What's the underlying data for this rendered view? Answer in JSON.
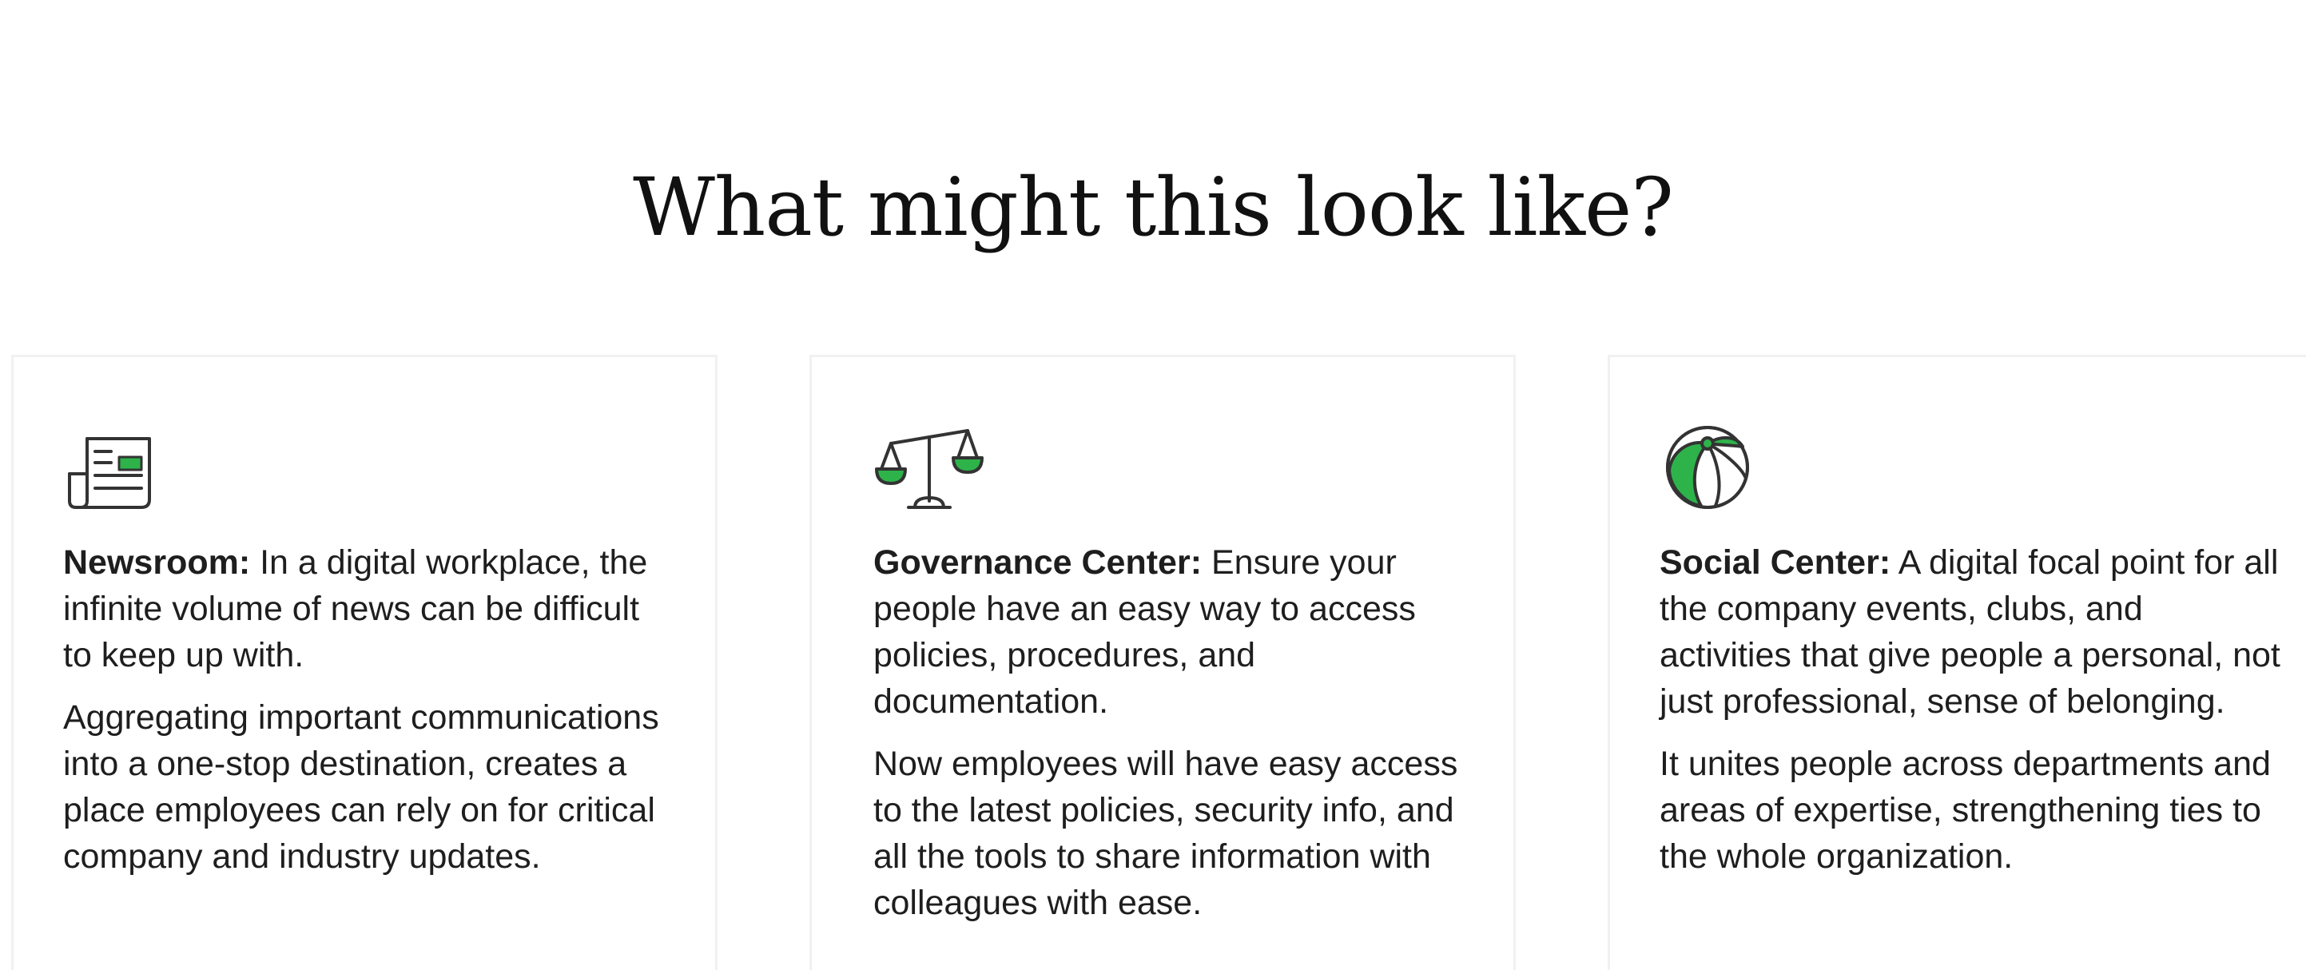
{
  "page": {
    "title": "What might this look like?"
  },
  "colors": {
    "accent_green": "#2db34a",
    "icon_stroke": "#333333",
    "card_border": "#f1f1f1"
  },
  "cards": [
    {
      "icon": "newspaper-icon",
      "heading": "Newsroom:",
      "intro": "In a digital workplace, the infinite volume of news can be difficult to keep up with.",
      "body": "Aggregating important communications into a one-stop destination, creates a place employees can rely on for critical company and industry updates."
    },
    {
      "icon": "scales-icon",
      "heading": "Governance Center:",
      "intro": "Ensure your people have an easy way to access policies, procedures, and documentation.",
      "body": "Now employees will have easy access to the latest policies, security info, and all the tools to share information with colleagues with ease."
    },
    {
      "icon": "beach-ball-icon",
      "heading": "Social Center:",
      "intro": "A digital focal point for all the company events, clubs, and activities that give people a personal, not just professional, sense of belonging.",
      "body": "It unites people across departments and areas of expertise, strengthening ties to the whole organization."
    }
  ]
}
